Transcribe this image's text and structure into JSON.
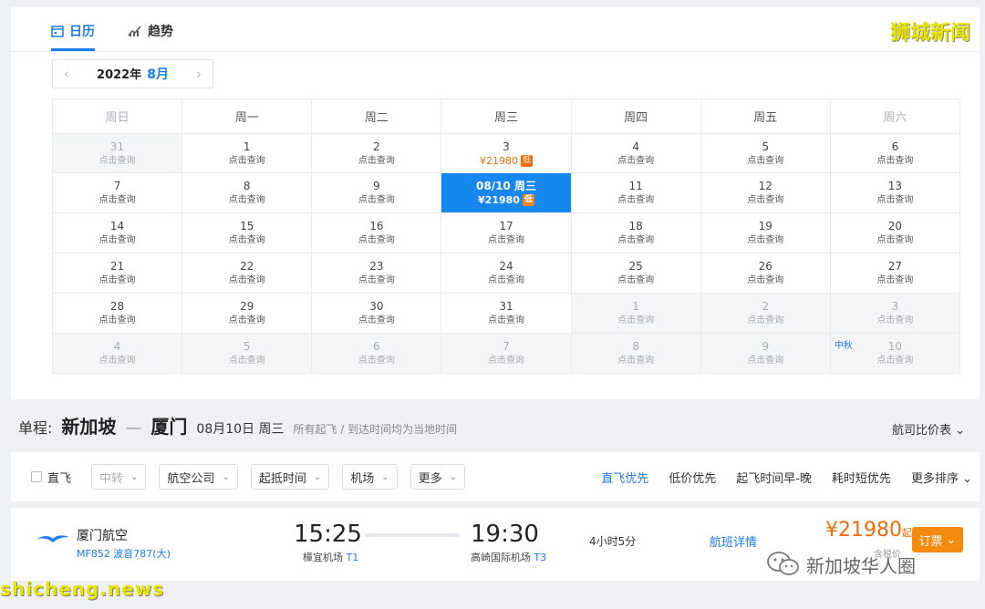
{
  "tabs": [
    {
      "label": "日历"
    },
    {
      "label": "趋势"
    }
  ],
  "calendar": {
    "year": "2022年",
    "month": "8月",
    "weekdays": [
      "周日",
      "周一",
      "周二",
      "周三",
      "周四",
      "周五",
      "周六"
    ],
    "query_text": "点击查询",
    "rows": [
      [
        {
          "d": "31",
          "dim": true
        },
        {
          "d": "1"
        },
        {
          "d": "2"
        },
        {
          "d": "3",
          "price": "¥21980",
          "low": "低"
        },
        {
          "d": "4"
        },
        {
          "d": "5"
        },
        {
          "d": "6"
        }
      ],
      [
        {
          "d": "7"
        },
        {
          "d": "8"
        },
        {
          "d": "9"
        },
        {
          "d": "08/10 周三",
          "price": "¥21980",
          "low": "低",
          "sel": true
        },
        {
          "d": "11"
        },
        {
          "d": "12"
        },
        {
          "d": "13"
        }
      ],
      [
        {
          "d": "14"
        },
        {
          "d": "15"
        },
        {
          "d": "16"
        },
        {
          "d": "17"
        },
        {
          "d": "18"
        },
        {
          "d": "19"
        },
        {
          "d": "20"
        }
      ],
      [
        {
          "d": "21"
        },
        {
          "d": "22"
        },
        {
          "d": "23"
        },
        {
          "d": "24"
        },
        {
          "d": "25"
        },
        {
          "d": "26"
        },
        {
          "d": "27"
        }
      ],
      [
        {
          "d": "28"
        },
        {
          "d": "29"
        },
        {
          "d": "30"
        },
        {
          "d": "31"
        },
        {
          "d": "1",
          "dim": true
        },
        {
          "d": "2",
          "dim": true
        },
        {
          "d": "3",
          "dim": true
        }
      ],
      [
        {
          "d": "4",
          "dim": true
        },
        {
          "d": "5",
          "dim": true
        },
        {
          "d": "6",
          "dim": true
        },
        {
          "d": "7",
          "dim": true
        },
        {
          "d": "8",
          "dim": true
        },
        {
          "d": "9",
          "dim": true
        },
        {
          "d": "10",
          "dim": true,
          "holiday": "中秋"
        }
      ]
    ]
  },
  "route": {
    "label": "单程:",
    "from": "新加坡",
    "to": "厦门",
    "date": "08月10日 周三",
    "note": "所有起飞 / 到达时间均为当地时间",
    "compare": "航司比价表"
  },
  "filters": {
    "direct": "直飞",
    "selects": [
      {
        "label": "中转",
        "disabled": true
      },
      {
        "label": "航空公司"
      },
      {
        "label": "起抵时间"
      },
      {
        "label": "机场"
      },
      {
        "label": "更多"
      }
    ],
    "sorts": [
      "直飞优先",
      "低价优先",
      "起飞时间早-晚",
      "耗时短优先",
      "更多排序"
    ]
  },
  "flight": {
    "airline": "厦门航空",
    "flight_no": "MF852 波音787(大)",
    "dep_time": "15:25",
    "dep_airport": "樟宜机场",
    "dep_terminal": "T1",
    "arr_time": "19:30",
    "arr_airport": "高崎国际机场",
    "arr_terminal": "T3",
    "duration": "4小时5分",
    "detail": "航班详情",
    "price": "¥21980",
    "price_suffix": "起",
    "tax": "含税价",
    "book": "订票"
  },
  "watermarks": {
    "top": "狮城新闻",
    "wechat": "新加坡华人圈",
    "bottom": "shicheng.news"
  },
  "colors": {
    "accent": "#1a7de8",
    "price": "#f06d06",
    "book": "#f58a10"
  }
}
